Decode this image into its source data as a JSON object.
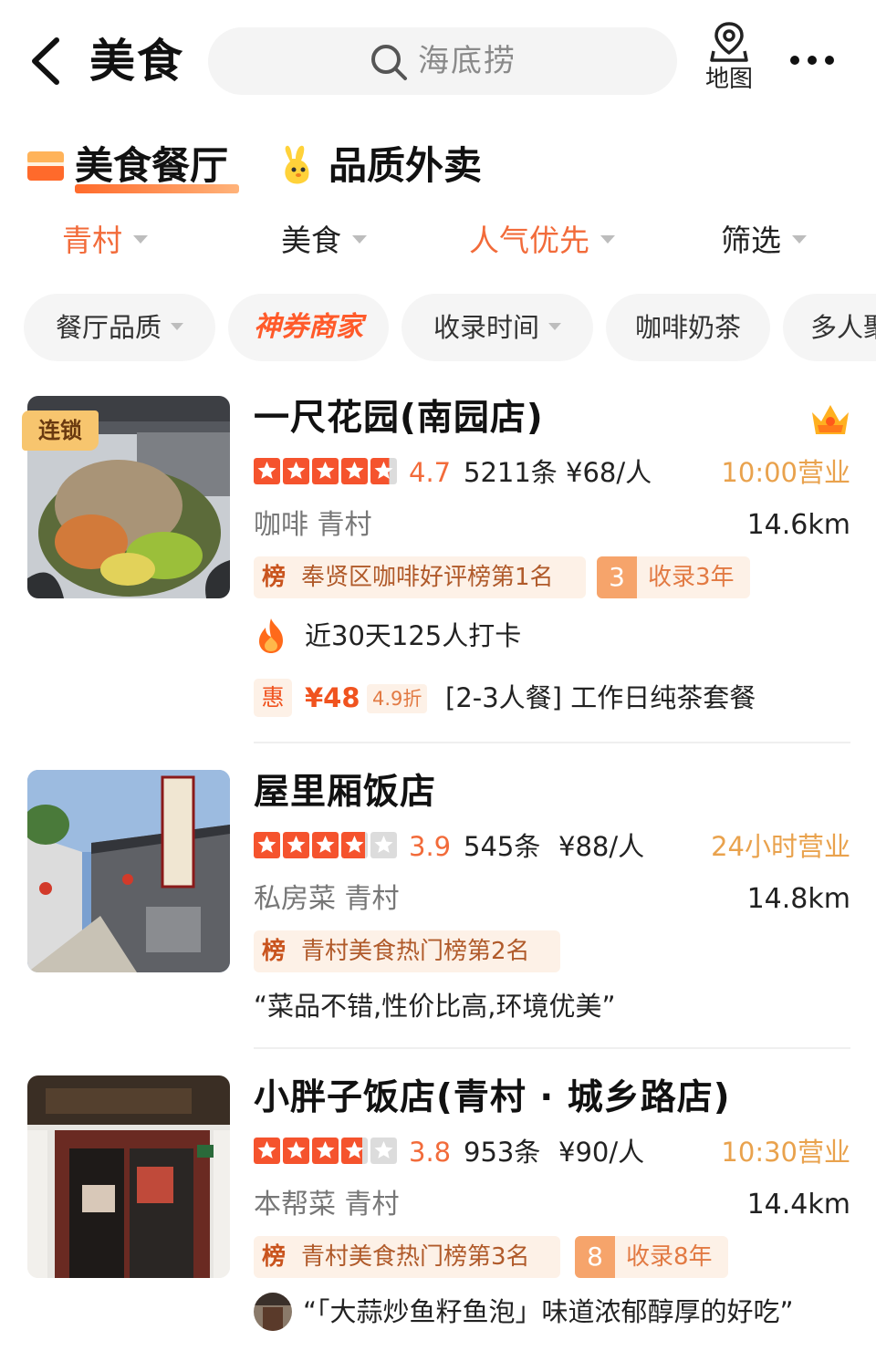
{
  "header": {
    "title": "美食",
    "search_placeholder": "海底捞",
    "map_label": "地图"
  },
  "category_tabs": [
    {
      "label": "美食餐厅",
      "active": true
    },
    {
      "label": "品质外卖",
      "active": false
    }
  ],
  "filters": [
    {
      "label": "青村",
      "active": true
    },
    {
      "label": "美食",
      "active": false
    },
    {
      "label": "人气优先",
      "active": true
    },
    {
      "label": "筛选",
      "active": false
    }
  ],
  "chips": [
    {
      "label": "餐厅品质",
      "dropdown": true
    },
    {
      "label": "神券商家",
      "dropdown": false
    },
    {
      "label": "收录时间",
      "dropdown": true
    },
    {
      "label": "咖啡奶茶",
      "dropdown": false
    },
    {
      "label": "多人聚",
      "dropdown": false
    }
  ],
  "colors": {
    "accent": "#f26b3a",
    "star_orange": "#f5532d",
    "star_empty": "#dcdcdc",
    "hours": "#e9a24d",
    "tag_bg": "#fdf1e7"
  },
  "listings": [
    {
      "name": "一尺花园(南园店)",
      "badge": "连锁",
      "crown_icon": "crown-icon",
      "rating": 4.7,
      "score": "4.7",
      "reviews": "5211条",
      "price": "¥68/人",
      "hours": "10:00营业",
      "tags": "咖啡  青村",
      "distance": "14.6km",
      "rank_mark": "榜",
      "rank_text": "奉贤区咖啡好评榜第1名",
      "years_num": "3",
      "years_text": "收录3年",
      "checkin": "近30天125人打卡",
      "deal_mark": "惠",
      "deal_price": "¥48",
      "deal_discount": "4.9折",
      "deal_text": "[2-3人餐] 工作日纯茶套餐"
    },
    {
      "name": "屋里厢饭店",
      "rating": 3.9,
      "score": "3.9",
      "reviews": "545条",
      "price": "¥88/人",
      "hours": "24小时营业",
      "tags": "私房菜  青村",
      "distance": "14.8km",
      "rank_mark": "榜",
      "rank_text": "青村美食热门榜第2名",
      "quote": "“菜品不错,性价比高,环境优美”"
    },
    {
      "name": "小胖子饭店(青村 · 城乡路店)",
      "rating": 3.8,
      "score": "3.8",
      "reviews": "953条",
      "price": "¥90/人",
      "hours": "10:30营业",
      "tags": "本帮菜  青村",
      "distance": "14.4km",
      "rank_mark": "榜",
      "rank_text": "青村美食热门榜第3名",
      "years_num": "8",
      "years_text": "收录8年",
      "quote": "“「大蒜炒鱼籽鱼泡」味道浓郁醇厚的好吃”"
    }
  ]
}
